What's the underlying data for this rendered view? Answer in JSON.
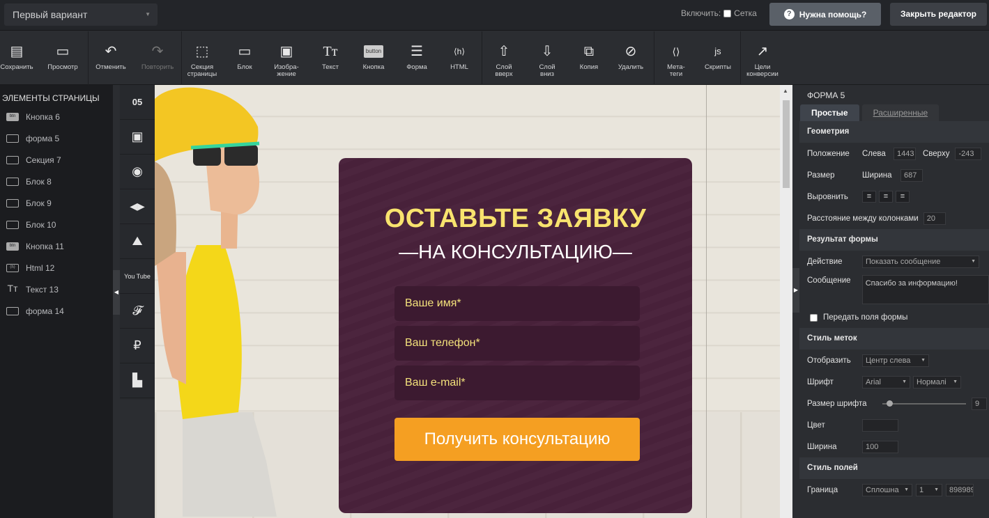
{
  "topbar": {
    "variant": "Первый вариант",
    "grid_label": "Включить:",
    "grid_checkbox": "Сетка",
    "help": "Нужна помощь?",
    "close": "Закрыть редактор"
  },
  "toolbar": [
    {
      "label": "Сохранить",
      "icon": "save-icon",
      "glyph": "💾"
    },
    {
      "label": "Просмотр",
      "icon": "monitor-icon",
      "glyph": "🖥"
    },
    {
      "label": "Отменить",
      "icon": "undo-icon",
      "glyph": "↶"
    },
    {
      "label": "Повторить",
      "icon": "redo-icon",
      "glyph": "↷"
    },
    {
      "label": "Секция страницы",
      "icon": "section-icon",
      "glyph": "⬚"
    },
    {
      "label": "Блок",
      "icon": "block-icon",
      "glyph": "▭"
    },
    {
      "label": "Изобра-жение",
      "icon": "image-icon",
      "glyph": "🖼"
    },
    {
      "label": "Текст",
      "icon": "text-icon",
      "glyph": "TT"
    },
    {
      "label": "Кнопка",
      "icon": "button-icon",
      "glyph": "button"
    },
    {
      "label": "Форма",
      "icon": "form-icon",
      "glyph": "☰"
    },
    {
      "label": "HTML",
      "icon": "html-icon",
      "glyph": "⟨h⟩"
    },
    {
      "label": "Слой вверх",
      "icon": "layer-up-icon",
      "glyph": "⇧"
    },
    {
      "label": "Слой вниз",
      "icon": "layer-down-icon",
      "glyph": "⇩"
    },
    {
      "label": "Копия",
      "icon": "copy-icon",
      "glyph": "⧉"
    },
    {
      "label": "Удалить",
      "icon": "delete-icon",
      "glyph": "⊘"
    },
    {
      "label": "Мета-теги",
      "icon": "meta-icon",
      "glyph": "⟨⟩"
    },
    {
      "label": "Скрипты",
      "icon": "scripts-icon",
      "glyph": "js"
    },
    {
      "label": "Цели конверсии",
      "icon": "conversion-icon",
      "glyph": "📈"
    }
  ],
  "sidebar": {
    "title": "ЭЛЕМЕНТЫ СТРАНИЦЫ",
    "items": [
      {
        "label": "Кнопка 6",
        "icon": "btn"
      },
      {
        "label": "форма 5",
        "icon": "form"
      },
      {
        "label": "Секция 7",
        "icon": "section"
      },
      {
        "label": "Блок 8",
        "icon": "block"
      },
      {
        "label": "Блок 9",
        "icon": "block"
      },
      {
        "label": "Блок 10",
        "icon": "block"
      },
      {
        "label": "Кнопка 11",
        "icon": "btn"
      },
      {
        "label": "Html 12",
        "icon": "html"
      },
      {
        "label": "Текст 13",
        "icon": "text"
      },
      {
        "label": "форма 14",
        "icon": "form"
      }
    ]
  },
  "widgets": [
    "05",
    "▣",
    "◉",
    "◀▶",
    "⛰",
    "You Tube",
    "𝓕",
    "₽",
    "▙"
  ],
  "form": {
    "title": "ОСТАВЬТЕ ЗАЯВКУ",
    "subtitle": "—НА КОНСУЛЬТАЦИЮ—",
    "fields": [
      "Ваше имя*",
      "Ваш телефон*",
      "Ваш e-mail*"
    ],
    "button": "Получить консультацию"
  },
  "panel": {
    "title": "ФОРМА 5",
    "tab_simple": "Простые",
    "tab_advanced": "Расширенные",
    "geometry": "Геометрия",
    "position": "Положение",
    "left_label": "Слева",
    "left_value": "1443",
    "top_label": "Сверху",
    "top_value": "-243",
    "size": "Размер",
    "width_label": "Ширина",
    "width_value": "687",
    "align": "Выровнить",
    "col_gap": "Расстояние между колонками",
    "col_gap_value": "20",
    "result": "Результат формы",
    "action": "Действие",
    "action_value": "Показать сообщение",
    "message": "Сообщение",
    "message_value": "Спасибо за информацию!",
    "pass_fields": "Передать поля формы",
    "label_style": "Стиль меток",
    "display": "Отобразить",
    "display_value": "Центр слева",
    "font": "Шрифт",
    "font_value": "Arial",
    "font_weight": "Нормалі",
    "font_size": "Размер шрифта",
    "font_size_value": "9",
    "font_size_level": 0.05,
    "color": "Цвет",
    "width2": "Ширина",
    "width2_value": "100",
    "field_style": "Стиль полей",
    "border": "Граница",
    "border_style": "Сплошна",
    "border_width": "1",
    "border_color": "898989"
  }
}
